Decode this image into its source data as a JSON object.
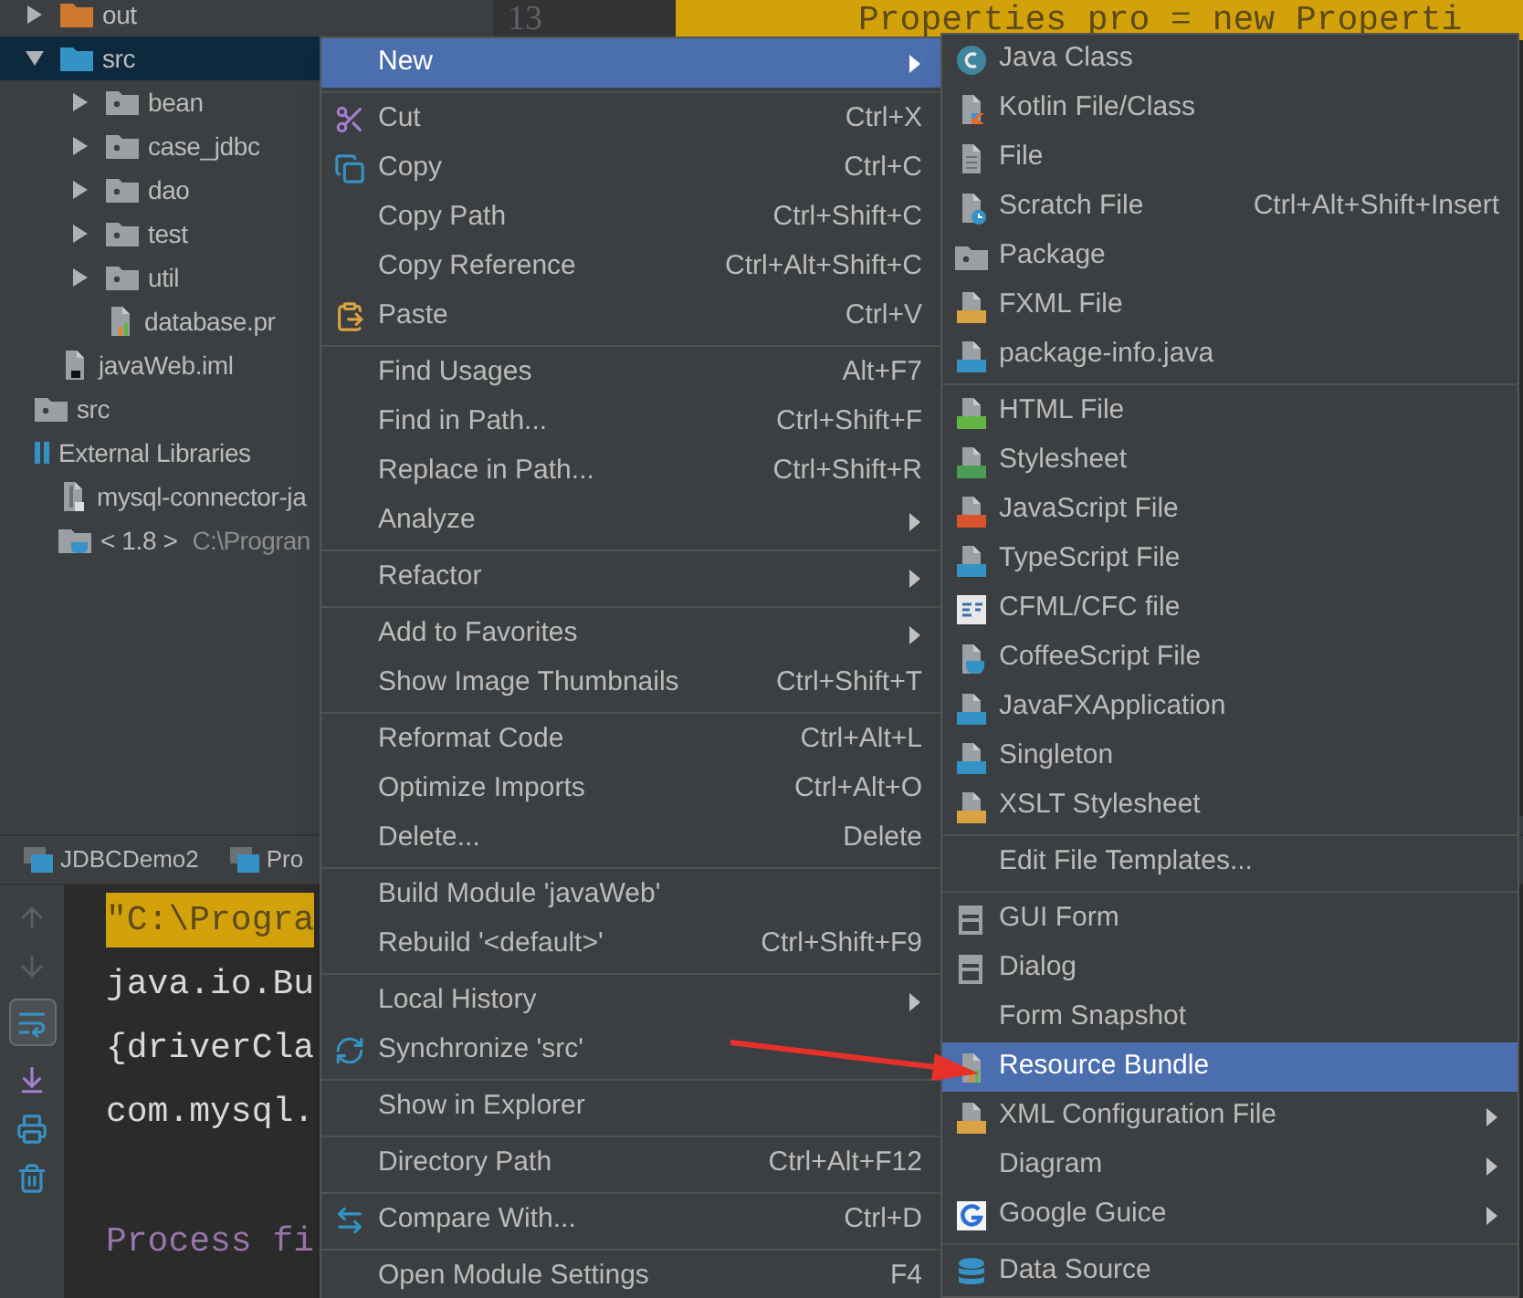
{
  "project_tree": {
    "module_items": [
      {
        "kind": "folder",
        "label": "out",
        "expanded": false,
        "selected": false
      },
      {
        "kind": "source_root",
        "label": "src",
        "expanded": true,
        "selected": true,
        "children": [
          {
            "kind": "package",
            "label": "bean",
            "expanded": false,
            "selected": false
          },
          {
            "kind": "package",
            "label": "case_jdbc",
            "expanded": false,
            "selected": false
          },
          {
            "kind": "package",
            "label": "dao",
            "expanded": false,
            "selected": false
          },
          {
            "kind": "package",
            "label": "test",
            "expanded": false,
            "selected": false
          },
          {
            "kind": "package",
            "label": "util",
            "expanded": false,
            "selected": false
          },
          {
            "kind": "properties",
            "label": "database.pr",
            "selected": false
          }
        ]
      },
      {
        "kind": "module_file",
        "label": "javaWeb.iml",
        "selected": false
      }
    ],
    "root_items": [
      {
        "kind": "plain_folder",
        "label": "src",
        "selected": false
      },
      {
        "kind": "libraries",
        "label": "External Libraries",
        "selected": false,
        "children": [
          {
            "kind": "jar",
            "label": "mysql-connector-ja",
            "selected": false
          },
          {
            "kind": "sdk",
            "label": "< 1.8 >",
            "path": "C:\\Progran",
            "selected": false
          }
        ]
      }
    ]
  },
  "editor": {
    "line_number": "13",
    "highlighted_line": "Properties pro = new Properti"
  },
  "run_panel": {
    "tabs": [
      {
        "label": "JDBCDemo2"
      },
      {
        "label": "Pro"
      }
    ],
    "soft_wrap_on": true,
    "lines": [
      {
        "kind": "command",
        "text": "\"C:\\Progra"
      },
      {
        "kind": "output",
        "text": "java.io.Bu"
      },
      {
        "kind": "output",
        "text": "{driverCla"
      },
      {
        "kind": "output",
        "text": "com.mysql."
      },
      {
        "kind": "exit",
        "text": "Process fi"
      }
    ]
  },
  "context_menu": {
    "sections": [
      {
        "items": [
          {
            "label": "New",
            "selected": true,
            "has_submenu": true
          }
        ]
      },
      {
        "items": [
          {
            "label": "Cut",
            "shortcut": "Ctrl+X",
            "selected": false,
            "has_submenu": false
          },
          {
            "label": "Copy",
            "shortcut": "Ctrl+C",
            "selected": false,
            "has_submenu": false
          },
          {
            "label": "Copy Path",
            "shortcut": "Ctrl+Shift+C",
            "selected": false,
            "has_submenu": false
          },
          {
            "label": "Copy Reference",
            "shortcut": "Ctrl+Alt+Shift+C",
            "selected": false,
            "has_submenu": false
          },
          {
            "label": "Paste",
            "shortcut": "Ctrl+V",
            "selected": false,
            "has_submenu": false
          }
        ]
      },
      {
        "items": [
          {
            "label": "Find Usages",
            "shortcut": "Alt+F7",
            "selected": false,
            "has_submenu": false
          },
          {
            "label": "Find in Path...",
            "shortcut": "Ctrl+Shift+F",
            "selected": false,
            "has_submenu": false
          },
          {
            "label": "Replace in Path...",
            "shortcut": "Ctrl+Shift+R",
            "selected": false,
            "has_submenu": false
          },
          {
            "label": "Analyze",
            "selected": false,
            "has_submenu": true
          }
        ]
      },
      {
        "items": [
          {
            "label": "Refactor",
            "selected": false,
            "has_submenu": true
          }
        ]
      },
      {
        "items": [
          {
            "label": "Add to Favorites",
            "selected": false,
            "has_submenu": true
          },
          {
            "label": "Show Image Thumbnails",
            "shortcut": "Ctrl+Shift+T",
            "selected": false,
            "has_submenu": false
          }
        ]
      },
      {
        "items": [
          {
            "label": "Reformat Code",
            "shortcut": "Ctrl+Alt+L",
            "selected": false,
            "has_submenu": false
          },
          {
            "label": "Optimize Imports",
            "shortcut": "Ctrl+Alt+O",
            "selected": false,
            "has_submenu": false
          },
          {
            "label": "Delete...",
            "shortcut": "Delete",
            "selected": false,
            "has_submenu": false
          }
        ]
      },
      {
        "items": [
          {
            "label": "Build Module 'javaWeb'",
            "selected": false,
            "has_submenu": false
          },
          {
            "label": "Rebuild '<default>'",
            "shortcut": "Ctrl+Shift+F9",
            "selected": false,
            "has_submenu": false
          }
        ]
      },
      {
        "items": [
          {
            "label": "Local History",
            "selected": false,
            "has_submenu": true
          },
          {
            "label": "Synchronize 'src'",
            "selected": false,
            "has_submenu": false
          }
        ]
      },
      {
        "items": [
          {
            "label": "Show in Explorer",
            "selected": false,
            "has_submenu": false
          }
        ]
      },
      {
        "items": [
          {
            "label": "Directory Path",
            "shortcut": "Ctrl+Alt+F12",
            "selected": false,
            "has_submenu": false
          }
        ]
      },
      {
        "items": [
          {
            "label": "Compare With...",
            "shortcut": "Ctrl+D",
            "selected": false,
            "has_submenu": false
          }
        ]
      },
      {
        "items": [
          {
            "label": "Open Module Settings",
            "shortcut": "F4",
            "selected": false,
            "has_submenu": false
          }
        ]
      }
    ]
  },
  "new_submenu": {
    "sections": [
      {
        "items": [
          {
            "label": "Java Class",
            "selected": false,
            "has_submenu": false
          },
          {
            "label": "Kotlin File/Class",
            "selected": false,
            "has_submenu": false
          },
          {
            "label": "File",
            "selected": false,
            "has_submenu": false
          },
          {
            "label": "Scratch File",
            "shortcut": "Ctrl+Alt+Shift+Insert",
            "selected": false,
            "has_submenu": false
          },
          {
            "label": "Package",
            "selected": false,
            "has_submenu": false
          },
          {
            "label": "FXML File",
            "selected": false,
            "has_submenu": false
          },
          {
            "label": "package-info.java",
            "selected": false,
            "has_submenu": false
          }
        ]
      },
      {
        "items": [
          {
            "label": "HTML File",
            "selected": false,
            "has_submenu": false
          },
          {
            "label": "Stylesheet",
            "selected": false,
            "has_submenu": false
          },
          {
            "label": "JavaScript File",
            "selected": false,
            "has_submenu": false
          },
          {
            "label": "TypeScript File",
            "selected": false,
            "has_submenu": false
          },
          {
            "label": "CFML/CFC file",
            "selected": false,
            "has_submenu": false
          },
          {
            "label": "CoffeeScript File",
            "selected": false,
            "has_submenu": false
          },
          {
            "label": "JavaFXApplication",
            "selected": false,
            "has_submenu": false
          },
          {
            "label": "Singleton",
            "selected": false,
            "has_submenu": false
          },
          {
            "label": "XSLT Stylesheet",
            "selected": false,
            "has_submenu": false
          }
        ]
      },
      {
        "items": [
          {
            "label": "Edit File Templates...",
            "selected": false,
            "has_submenu": false
          }
        ]
      },
      {
        "items": [
          {
            "label": "GUI Form",
            "selected": false,
            "has_submenu": false
          },
          {
            "label": "Dialog",
            "selected": false,
            "has_submenu": false
          },
          {
            "label": "Form Snapshot",
            "selected": false,
            "has_submenu": false
          },
          {
            "label": "Resource Bundle",
            "selected": true,
            "has_submenu": false
          },
          {
            "label": "XML Configuration File",
            "selected": false,
            "has_submenu": true
          },
          {
            "label": "Diagram",
            "selected": false,
            "has_submenu": true
          },
          {
            "label": "Google Guice",
            "selected": false,
            "has_submenu": true
          }
        ]
      },
      {
        "items": [
          {
            "label": "Data Source",
            "selected": false,
            "has_submenu": false
          }
        ]
      }
    ]
  }
}
